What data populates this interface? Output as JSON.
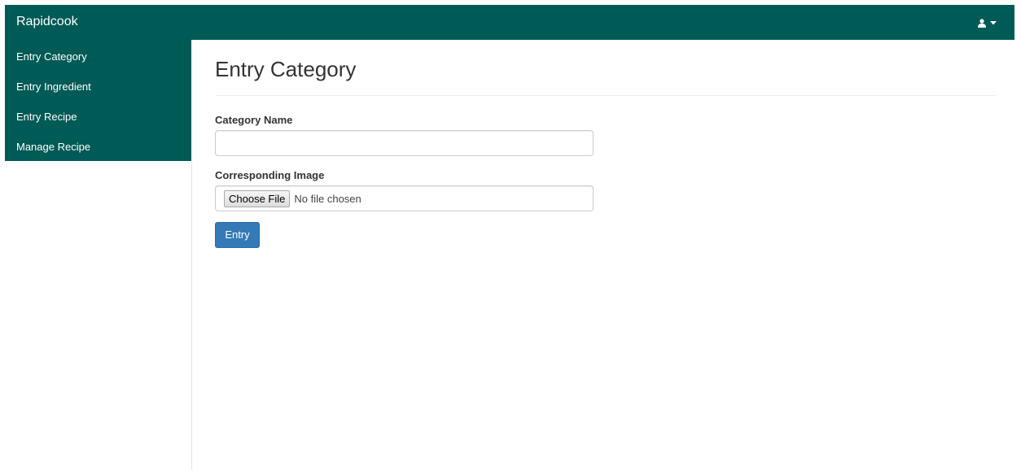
{
  "app": {
    "brand": "Rapidcook",
    "accent_color": "#005a56",
    "user_menu_icon": "user-icon",
    "dropdown_icon": "caret-down-icon"
  },
  "sidebar": {
    "items": [
      {
        "label": "Entry Category"
      },
      {
        "label": "Entry Ingredient"
      },
      {
        "label": "Entry Recipe"
      },
      {
        "label": "Manage Recipe"
      }
    ]
  },
  "page": {
    "title": "Entry Category"
  },
  "form": {
    "category_name": {
      "label": "Category Name",
      "value": ""
    },
    "image": {
      "label": "Corresponding Image",
      "button_label": "Choose File",
      "status": "No file chosen"
    },
    "submit_label": "Entry",
    "submit_color": "#337ab7"
  }
}
